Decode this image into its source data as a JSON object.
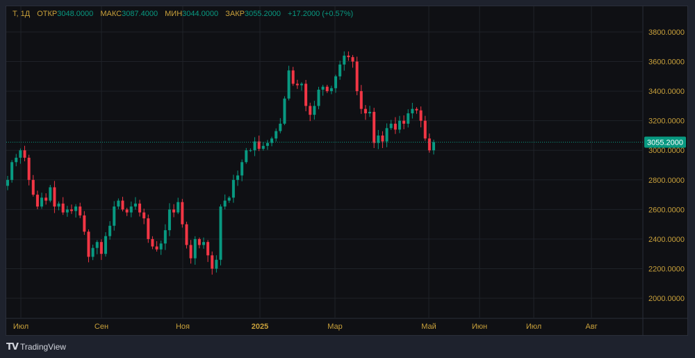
{
  "legend": {
    "symbol": "T, 1Д",
    "open_label": "ОТКР",
    "open": "3048.0000",
    "high_label": "МАКС",
    "high": "3087.4000",
    "low_label": "МИН",
    "low": "3044.0000",
    "close_label": "ЗАКР",
    "close": "3055.2000",
    "change": "+17.2000 (+0.57%)"
  },
  "brand": {
    "logo": "TV",
    "name": "TradingView"
  },
  "colors": {
    "up": "#089981",
    "down": "#f23645",
    "tick": "#c9a13b",
    "background": "#0f1014",
    "grid": "#1f2228"
  },
  "chart_data": {
    "type": "candlestick",
    "interval": "1D",
    "y_ticks": [
      "3800.0000",
      "3600.0000",
      "3400.0000",
      "3200.0000",
      "3000.0000",
      "2800.0000",
      "2600.0000",
      "2400.0000",
      "2200.0000",
      "2000.0000"
    ],
    "ylim": [
      1900,
      3850
    ],
    "x_ticks": [
      "Июл",
      "Сен",
      "Ноя",
      "2025",
      "Мар",
      "Май",
      "Июн",
      "Июл",
      "Авг"
    ],
    "last_price": "3055.2000",
    "grid": true,
    "closes": [
      2800,
      2920,
      2950,
      3000,
      2950,
      2800,
      2700,
      2620,
      2680,
      2660,
      2750,
      2620,
      2640,
      2580,
      2600,
      2590,
      2620,
      2560,
      2450,
      2280,
      2340,
      2380,
      2300,
      2420,
      2490,
      2620,
      2660,
      2600,
      2580,
      2620,
      2640,
      2580,
      2540,
      2400,
      2350,
      2330,
      2370,
      2460,
      2600,
      2580,
      2650,
      2500,
      2360,
      2270,
      2400,
      2360,
      2380,
      2290,
      2200,
      2260,
      2620,
      2660,
      2680,
      2800,
      2830,
      2920,
      3000,
      3000,
      3060,
      3010,
      3030,
      3050,
      3080,
      3130,
      3180,
      3350,
      3540,
      3450,
      3440,
      3450,
      3300,
      3240,
      3300,
      3410,
      3430,
      3400,
      3420,
      3500,
      3580,
      3640,
      3630,
      3600,
      3400,
      3280,
      3250,
      3260,
      3050,
      3100,
      3060,
      3150,
      3180,
      3140,
      3200,
      3180,
      3250,
      3280,
      3270,
      3200,
      3080,
      3000,
      3055.2
    ]
  }
}
